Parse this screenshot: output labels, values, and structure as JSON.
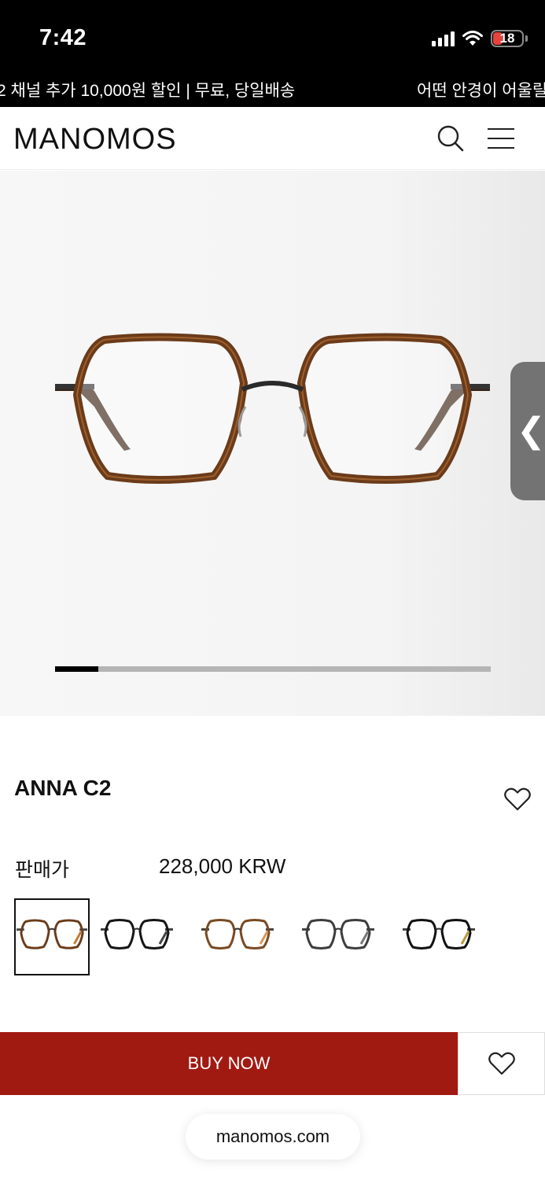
{
  "status": {
    "time": "7:42",
    "battery": "18"
  },
  "banner": {
    "text_left": "2 채널 추가 10,000원 할인 | 무료, 당일배송",
    "text_right": "어떤 안경이 어울릴"
  },
  "header": {
    "logo": "MANOMOS",
    "icons": [
      "search-icon",
      "menu-icon"
    ]
  },
  "gallery": {
    "progress": 0.1,
    "handle_icon": "chevron-left-icon"
  },
  "product": {
    "name": "ANNA C2",
    "price_label": "판매가",
    "price": "228,000 KRW",
    "variants": [
      {
        "frame": "#6b3b1a",
        "accent": "#c07a3a",
        "selected": true
      },
      {
        "frame": "#151515",
        "accent": "#444444",
        "selected": false
      },
      {
        "frame": "#7a4a22",
        "accent": "#d49a56",
        "selected": false
      },
      {
        "frame": "#3d3d3d",
        "accent": "#777777",
        "selected": false
      },
      {
        "frame": "#111111",
        "accent": "#b39b3c",
        "selected": false
      }
    ]
  },
  "actions": {
    "buy_label": "BUY NOW"
  },
  "browser": {
    "url": "manomos.com"
  },
  "colors": {
    "buy": "#a11a12",
    "tortoise": "#6b3b1a"
  }
}
